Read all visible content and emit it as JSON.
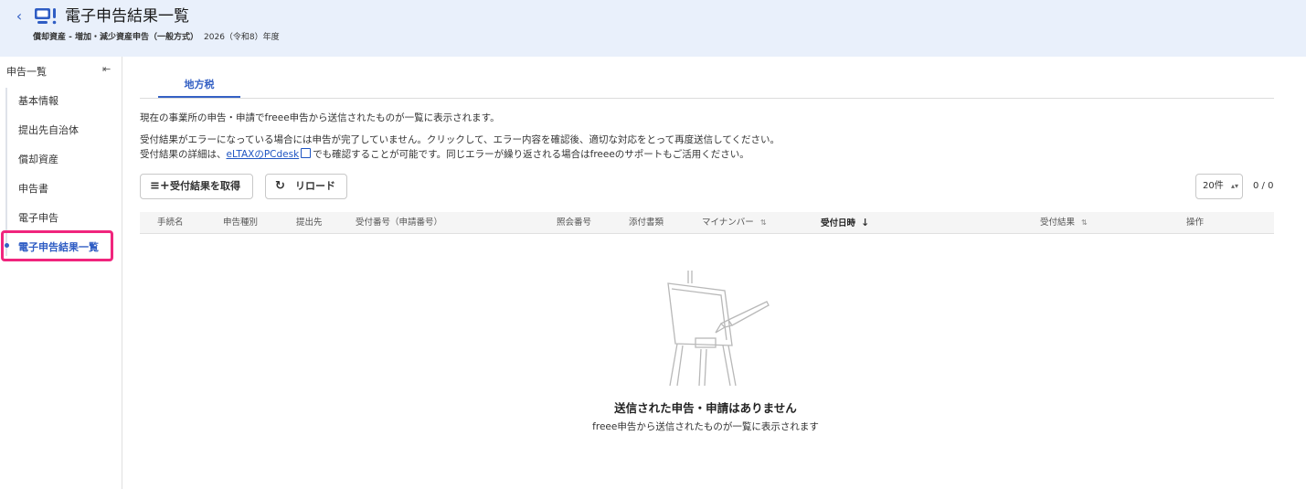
{
  "header": {
    "back_icon": "chevron-left-icon",
    "title": "電子申告結果一覧",
    "subtitle_main": "償却資産 - 増加・減少資産申告（一般方式）",
    "subtitle_year": "2026（令和8）年度"
  },
  "sidebar": {
    "heading": "申告一覧",
    "collapse_icon": "collapse-sidebar-icon",
    "items": [
      {
        "label": "基本情報"
      },
      {
        "label": "提出先自治体"
      },
      {
        "label": "償却資産"
      },
      {
        "label": "申告書"
      },
      {
        "label": "電子申告"
      },
      {
        "label": "電子申告結果一覧",
        "active": true
      }
    ]
  },
  "tabs": [
    {
      "label": "地方税",
      "active": true
    }
  ],
  "description": {
    "line1": "現在の事業所の申告・申請でfreee申告から送信されたものが一覧に表示されます。",
    "line2": "受付結果がエラーになっている場合には申告が完了していません。クリックして、エラー内容を確認後、適切な対応をとって再度送信してください。",
    "line3_prefix": "受付結果の詳細は、",
    "line3_link": "eLTAXのPCdesk",
    "line3_suffix": "でも確認することが可能です。同じエラーが繰り返される場合はfreeeのサポートもご活用ください。"
  },
  "toolbar": {
    "fetch_label": "受付結果を取得",
    "reload_label": "リロード",
    "per_page": "20件",
    "count": "0 / 0"
  },
  "table": {
    "columns": [
      "手続名",
      "申告種別",
      "提出先",
      "受付番号（申請番号）",
      "照会番号",
      "添付書類",
      "マイナンバー",
      "受付日時",
      "受付結果",
      "操作"
    ]
  },
  "empty": {
    "title": "送信された申告・申請はありません",
    "subtitle": "freee申告から送信されたものが一覧に表示されます"
  },
  "colors": {
    "accent": "#3561c4",
    "highlight": "#f0257d",
    "header_bg": "#e9f0fb"
  }
}
